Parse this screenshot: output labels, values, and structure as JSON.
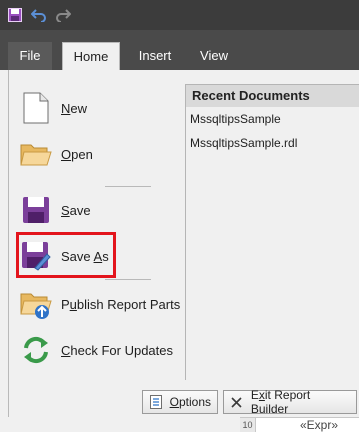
{
  "titlebar": {
    "icons": [
      "save-icon",
      "undo-icon",
      "redo-icon"
    ]
  },
  "tabs": [
    {
      "label": "File"
    },
    {
      "label": "Home"
    },
    {
      "label": "Insert"
    },
    {
      "label": "View"
    }
  ],
  "menu": {
    "new": {
      "pre": "",
      "key": "N",
      "post": "ew",
      "icon": "new-document-icon"
    },
    "open": {
      "pre": "",
      "key": "O",
      "post": "pen",
      "icon": "folder-icon"
    },
    "save": {
      "pre": "",
      "key": "S",
      "post": "ave",
      "icon": "floppy-disk-icon"
    },
    "save_as": {
      "pre": "Save ",
      "key": "A",
      "post": "s",
      "icon": "save-as-icon"
    },
    "publish": {
      "pre": "P",
      "key": "u",
      "post": "blish Report Parts",
      "icon": "publish-folder-icon"
    },
    "updates": {
      "pre": "",
      "key": "C",
      "post": "heck For Updates",
      "icon": "refresh-icon"
    }
  },
  "recent": {
    "header": "Recent Documents",
    "items": [
      "MssqltipsSample",
      "MssqltipsSample.rdl"
    ]
  },
  "buttons": {
    "options": {
      "pre": "",
      "key": "O",
      "post": "ptions",
      "icon": "options-icon"
    },
    "exit": {
      "pre": "E",
      "key": "x",
      "post": "it Report Builder",
      "icon": "close-icon"
    }
  },
  "document_fragment": {
    "ruler": "10",
    "expr": "«Expr»"
  },
  "colors": {
    "titlebar": "#3c3c3c",
    "tabrow": "#4a4a4a",
    "highlight": "#e3141c",
    "save_purple": "#7b3f9a"
  }
}
